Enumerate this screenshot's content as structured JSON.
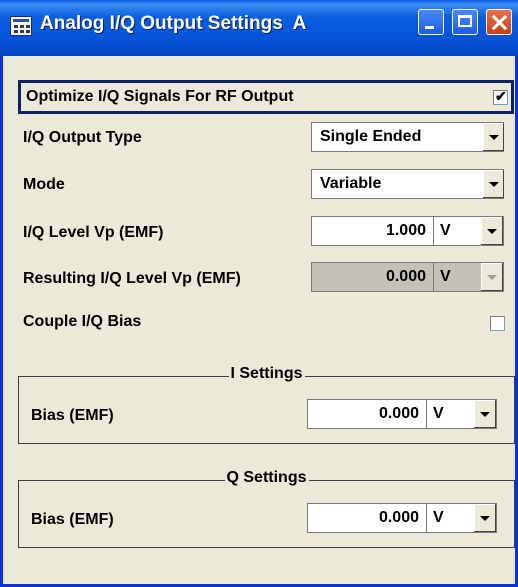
{
  "window": {
    "title": "Analog I/Q Output Settings  A",
    "title_icon": "settings-dialog-icon",
    "controls": [
      "minimize-icon",
      "maximize-icon",
      "close-icon"
    ]
  },
  "optimize": {
    "label": "Optimize I/Q Signals For RF Output",
    "checked": true,
    "mark": "✔"
  },
  "output_type": {
    "label": "I/Q Output Type",
    "value": "Single Ended"
  },
  "mode": {
    "label": "Mode",
    "value": "Variable"
  },
  "level": {
    "label": "I/Q Level Vp (EMF)",
    "value": "1.000",
    "unit": "V"
  },
  "resulting_level": {
    "label": "Resulting I/Q Level Vp (EMF)",
    "value": "0.000",
    "unit": "V"
  },
  "couple_bias": {
    "label": "Couple I/Q Bias",
    "checked": false
  },
  "i_settings": {
    "title": "I Settings",
    "bias_label": "Bias (EMF)",
    "bias_value": "0.000",
    "bias_unit": "V"
  },
  "q_settings": {
    "title": "Q Settings",
    "bias_label": "Bias (EMF)",
    "bias_value": "0.000",
    "bias_unit": "V"
  },
  "colors": {
    "titlebar": "#0553d6",
    "window_bg": "#ece9d8",
    "focus_border": "#0a246a",
    "disabled_field": "#c4c1b6"
  }
}
